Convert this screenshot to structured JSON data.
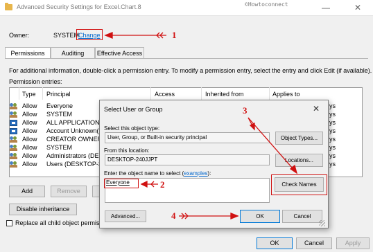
{
  "window": {
    "title": "Advanced Security Settings for Excel.Chart.8",
    "watermark": "©Howtoconnect",
    "minimize_glyph": "—",
    "close_glyph": "✕"
  },
  "owner": {
    "label": "Owner:",
    "value": "SYSTEM",
    "change_link": "Change"
  },
  "tabs": [
    "Permissions",
    "Auditing",
    "Effective Access"
  ],
  "info_text": "For additional information, double-click a permission entry. To modify a permission entry, select the entry and click Edit (if available).",
  "permission_entries_label": "Permission entries:",
  "columns": [
    "Type",
    "Principal",
    "Access",
    "Inherited from",
    "Applies to"
  ],
  "rows": [
    {
      "icon": "users-icon",
      "type": "Allow",
      "principal": "Everyone",
      "applies_to": "ys"
    },
    {
      "icon": "users-icon",
      "type": "Allow",
      "principal": "SYSTEM",
      "applies_to": "ys"
    },
    {
      "icon": "app-package-icon",
      "type": "Allow",
      "principal": "ALL APPLICATION PA",
      "applies_to": "ys"
    },
    {
      "icon": "app-package-icon",
      "type": "Allow",
      "principal": "Account Unknown(S",
      "applies_to": "ys"
    },
    {
      "icon": "users-icon",
      "type": "Allow",
      "principal": "CREATOR OWNER",
      "applies_to": "ys"
    },
    {
      "icon": "users-icon",
      "type": "Allow",
      "principal": "SYSTEM",
      "applies_to": "ys"
    },
    {
      "icon": "users-icon",
      "type": "Allow",
      "principal": "Administrators (DESK",
      "applies_to": "ys"
    },
    {
      "icon": "users-icon",
      "type": "Allow",
      "principal": "Users (DESKTOP-240J",
      "applies_to": "ys"
    }
  ],
  "buttons": {
    "add": "Add",
    "remove": "Remove",
    "disable_inheritance": "Disable inheritance",
    "ok": "OK",
    "cancel": "Cancel",
    "apply": "Apply"
  },
  "replace_label": "Replace all child object permissio",
  "dialog": {
    "title": "Select User or Group",
    "close_glyph": "✕",
    "object_type_label": "Select this object type:",
    "object_type_value": "User, Group, or Built-in security principal",
    "object_types_button": "Object Types...",
    "location_label": "From this location:",
    "location_value": "DESKTOP-240JJPT",
    "locations_button": "Locations...",
    "enter_label": "Enter the object name to select (",
    "enter_link": "examples",
    "enter_label_end": "):",
    "name_value": "Everyone",
    "check_names_button": "Check Names",
    "advanced_button": "Advanced...",
    "ok_button": "OK",
    "cancel_button": "Cancel"
  },
  "annotations": {
    "step1": "1",
    "step2": "2",
    "step3": "3",
    "step4": "4",
    "color": "#d01010"
  },
  "colors": {
    "link": "#0066cc",
    "accent_border": "#0078d7",
    "title_text": "#7a7a7a"
  }
}
